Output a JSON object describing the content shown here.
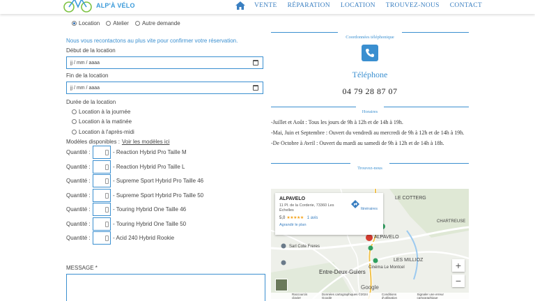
{
  "header": {
    "logo_text": "ALP'À VÉLO",
    "nav": [
      "VENTE",
      "RÉPARATION",
      "LOCATION",
      "TROUVEZ-NOUS",
      "CONTACT"
    ]
  },
  "form": {
    "request_types": [
      {
        "label": "Location",
        "checked": true
      },
      {
        "label": "Atelier",
        "checked": false
      },
      {
        "label": "Autre demande",
        "checked": false
      }
    ],
    "info_text": "Nous vous recontactons au plus vite pour confirmer votre réservation.",
    "start_label": "Début de la location",
    "start_placeholder": "jj / mm / aaaa",
    "end_label": "Fin de la location",
    "end_placeholder": "jj / mm / aaaa",
    "duration_label": "Durée de la location",
    "durations": [
      "Location à la journée",
      "Location à la matinée",
      "Location à l'après-midi"
    ],
    "models_label": "Modèles disponibles :",
    "models_link": "Voir les modèles ici",
    "quantity_label": "Quantité :",
    "models": [
      "- Reaction Hybrid Pro Taille M",
      "- Reaction Hybrid Pro Taille L",
      "- Supreme Sport Hybrid Pro Taille 46",
      "- Supreme Sport Hybrid Pro Taille 50",
      "- Touring Hybrid One Taille 46",
      "- Touring Hybrid One Taille 50",
      "- Acid 240 Hybrid Rookie"
    ],
    "message_label": "MESSAGE *"
  },
  "contact": {
    "phone_section_title": "Coordonnées téléphonique",
    "phone_title": "Téléphone",
    "phone_number": "04 79 28 87 07",
    "hours_section_title": "Horaires",
    "hours": [
      "-Juillet et Août : Tous les jours de 9h à 12h et de 14h à 19h.",
      "-Mai, Juin et Septembre : Ouvert du vendredi au mercredi de 9h à 12h et de 14h à 19h.",
      "-De Octobre à Avril : Ouvert du mardi au samedi de 9h à 12h et de 14h à 18h."
    ],
    "map_section_title": "Trouvez-nous"
  },
  "map": {
    "place_name": "ALPAVELO",
    "address": "11 Pl. de la Corderie, 73360 Les Échelles",
    "rating": "5,0",
    "stars": "★★★★★",
    "reviews": "1 avis",
    "directions": "Itinéraires",
    "enlarge": "Agrandir le plan",
    "zoom_in": "+",
    "zoom_out": "−",
    "labels": {
      "cotteri": "LE COTTERG",
      "alpavelo": "ALPAVELO",
      "chartreuse": "CHARTREUSE",
      "sarl": "Sarl Cote Freres",
      "millioz": "LES MILLIOZ",
      "entre": "Entre-Deux-Guiers",
      "cinema": "Cinéma Le Montcel",
      "google": "Google"
    },
    "footer": [
      "Raccourcis clavier",
      "Données cartographiques ©2024 Google",
      "Conditions d'utilisation",
      "Signaler une erreur cartographique"
    ]
  }
}
